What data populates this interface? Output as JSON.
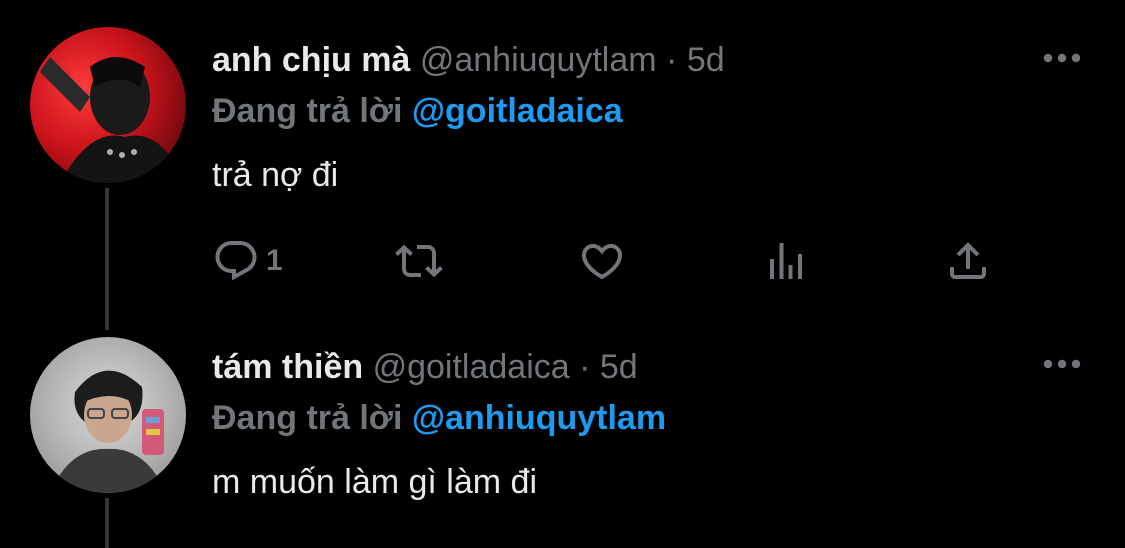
{
  "tweets": [
    {
      "name": "anh chịu mà",
      "handle": "@anhiuquytlam",
      "separator": "·",
      "time": "5d",
      "replying_prefix": "Đang trả lời",
      "replying_to": "@goitladaica",
      "text": "trả nợ đi",
      "reply_count": "1",
      "avatar_icon": "profile-photo-red"
    },
    {
      "name": "tám thiền",
      "handle": "@goitladaica",
      "separator": "·",
      "time": "5d",
      "replying_prefix": "Đang trả lời",
      "replying_to": "@anhiuquytlam",
      "text": "m muốn làm gì làm đi",
      "avatar_icon": "profile-photo-grey"
    }
  ],
  "colors": {
    "background": "#000000",
    "text": "#e7e9ea",
    "muted": "#71767b",
    "mention": "#1d9bf0",
    "thread_line": "#333639"
  }
}
